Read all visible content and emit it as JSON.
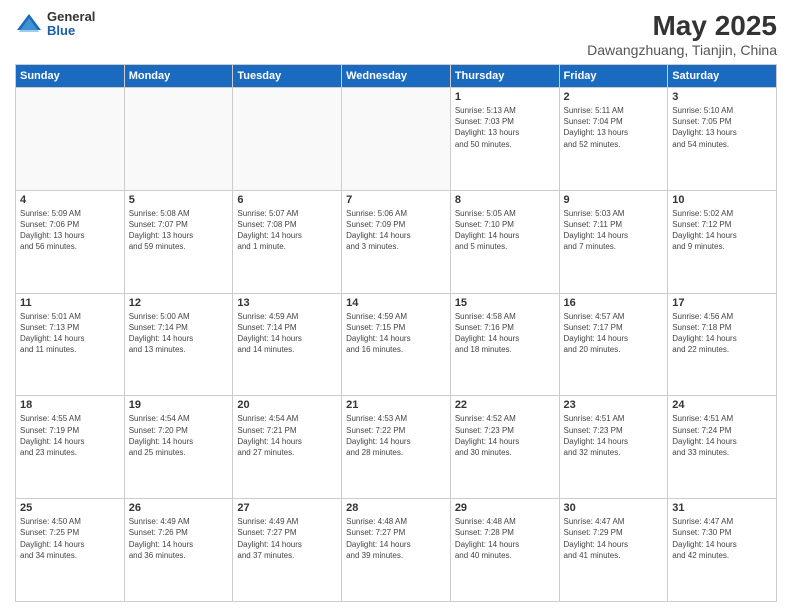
{
  "header": {
    "logo_general": "General",
    "logo_blue": "Blue",
    "title": "May 2025",
    "location": "Dawangzhuang, Tianjin, China"
  },
  "days_of_week": [
    "Sunday",
    "Monday",
    "Tuesday",
    "Wednesday",
    "Thursday",
    "Friday",
    "Saturday"
  ],
  "weeks": [
    [
      {
        "day": "",
        "info": ""
      },
      {
        "day": "",
        "info": ""
      },
      {
        "day": "",
        "info": ""
      },
      {
        "day": "",
        "info": ""
      },
      {
        "day": "1",
        "info": "Sunrise: 5:13 AM\nSunset: 7:03 PM\nDaylight: 13 hours\nand 50 minutes."
      },
      {
        "day": "2",
        "info": "Sunrise: 5:11 AM\nSunset: 7:04 PM\nDaylight: 13 hours\nand 52 minutes."
      },
      {
        "day": "3",
        "info": "Sunrise: 5:10 AM\nSunset: 7:05 PM\nDaylight: 13 hours\nand 54 minutes."
      }
    ],
    [
      {
        "day": "4",
        "info": "Sunrise: 5:09 AM\nSunset: 7:06 PM\nDaylight: 13 hours\nand 56 minutes."
      },
      {
        "day": "5",
        "info": "Sunrise: 5:08 AM\nSunset: 7:07 PM\nDaylight: 13 hours\nand 59 minutes."
      },
      {
        "day": "6",
        "info": "Sunrise: 5:07 AM\nSunset: 7:08 PM\nDaylight: 14 hours\nand 1 minute."
      },
      {
        "day": "7",
        "info": "Sunrise: 5:06 AM\nSunset: 7:09 PM\nDaylight: 14 hours\nand 3 minutes."
      },
      {
        "day": "8",
        "info": "Sunrise: 5:05 AM\nSunset: 7:10 PM\nDaylight: 14 hours\nand 5 minutes."
      },
      {
        "day": "9",
        "info": "Sunrise: 5:03 AM\nSunset: 7:11 PM\nDaylight: 14 hours\nand 7 minutes."
      },
      {
        "day": "10",
        "info": "Sunrise: 5:02 AM\nSunset: 7:12 PM\nDaylight: 14 hours\nand 9 minutes."
      }
    ],
    [
      {
        "day": "11",
        "info": "Sunrise: 5:01 AM\nSunset: 7:13 PM\nDaylight: 14 hours\nand 11 minutes."
      },
      {
        "day": "12",
        "info": "Sunrise: 5:00 AM\nSunset: 7:14 PM\nDaylight: 14 hours\nand 13 minutes."
      },
      {
        "day": "13",
        "info": "Sunrise: 4:59 AM\nSunset: 7:14 PM\nDaylight: 14 hours\nand 14 minutes."
      },
      {
        "day": "14",
        "info": "Sunrise: 4:59 AM\nSunset: 7:15 PM\nDaylight: 14 hours\nand 16 minutes."
      },
      {
        "day": "15",
        "info": "Sunrise: 4:58 AM\nSunset: 7:16 PM\nDaylight: 14 hours\nand 18 minutes."
      },
      {
        "day": "16",
        "info": "Sunrise: 4:57 AM\nSunset: 7:17 PM\nDaylight: 14 hours\nand 20 minutes."
      },
      {
        "day": "17",
        "info": "Sunrise: 4:56 AM\nSunset: 7:18 PM\nDaylight: 14 hours\nand 22 minutes."
      }
    ],
    [
      {
        "day": "18",
        "info": "Sunrise: 4:55 AM\nSunset: 7:19 PM\nDaylight: 14 hours\nand 23 minutes."
      },
      {
        "day": "19",
        "info": "Sunrise: 4:54 AM\nSunset: 7:20 PM\nDaylight: 14 hours\nand 25 minutes."
      },
      {
        "day": "20",
        "info": "Sunrise: 4:54 AM\nSunset: 7:21 PM\nDaylight: 14 hours\nand 27 minutes."
      },
      {
        "day": "21",
        "info": "Sunrise: 4:53 AM\nSunset: 7:22 PM\nDaylight: 14 hours\nand 28 minutes."
      },
      {
        "day": "22",
        "info": "Sunrise: 4:52 AM\nSunset: 7:23 PM\nDaylight: 14 hours\nand 30 minutes."
      },
      {
        "day": "23",
        "info": "Sunrise: 4:51 AM\nSunset: 7:23 PM\nDaylight: 14 hours\nand 32 minutes."
      },
      {
        "day": "24",
        "info": "Sunrise: 4:51 AM\nSunset: 7:24 PM\nDaylight: 14 hours\nand 33 minutes."
      }
    ],
    [
      {
        "day": "25",
        "info": "Sunrise: 4:50 AM\nSunset: 7:25 PM\nDaylight: 14 hours\nand 34 minutes."
      },
      {
        "day": "26",
        "info": "Sunrise: 4:49 AM\nSunset: 7:26 PM\nDaylight: 14 hours\nand 36 minutes."
      },
      {
        "day": "27",
        "info": "Sunrise: 4:49 AM\nSunset: 7:27 PM\nDaylight: 14 hours\nand 37 minutes."
      },
      {
        "day": "28",
        "info": "Sunrise: 4:48 AM\nSunset: 7:27 PM\nDaylight: 14 hours\nand 39 minutes."
      },
      {
        "day": "29",
        "info": "Sunrise: 4:48 AM\nSunset: 7:28 PM\nDaylight: 14 hours\nand 40 minutes."
      },
      {
        "day": "30",
        "info": "Sunrise: 4:47 AM\nSunset: 7:29 PM\nDaylight: 14 hours\nand 41 minutes."
      },
      {
        "day": "31",
        "info": "Sunrise: 4:47 AM\nSunset: 7:30 PM\nDaylight: 14 hours\nand 42 minutes."
      }
    ]
  ]
}
